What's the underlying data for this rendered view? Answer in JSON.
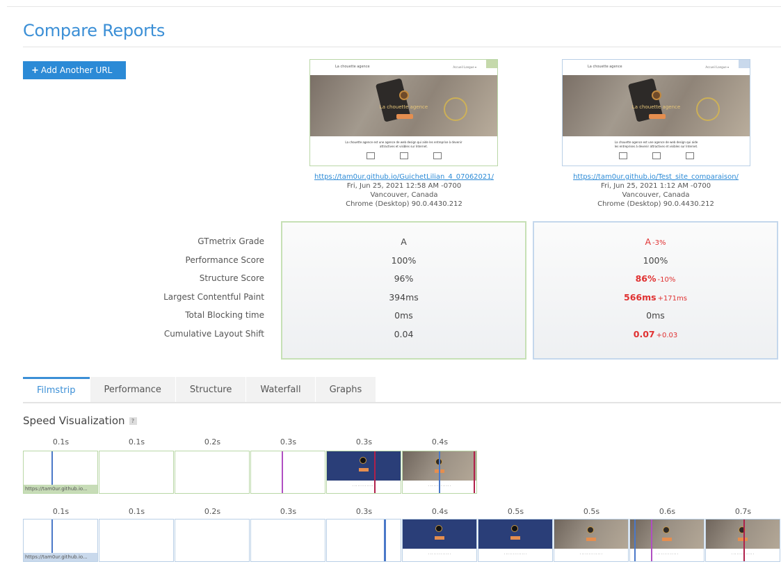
{
  "page": {
    "title": "Compare Reports"
  },
  "actions": {
    "add_url_label": "Add Another URL"
  },
  "colors": {
    "accent": "#3b8fd6",
    "report1_border": "#c6e0b5",
    "report2_border": "#c4d7ec",
    "good": "#3bb33b",
    "bad": "#e03131",
    "marker_purple": "#b04fc2",
    "marker_blue": "#4a78c8",
    "marker_red": "#b0204a"
  },
  "reports": [
    {
      "url": "https://tam0ur.github.io/GuichetLilian_4_07062021/",
      "date": "Fri, Jun 25, 2021 12:58 AM -0700",
      "location": "Vancouver, Canada",
      "browser": "Chrome (Desktop) 90.0.4430.212",
      "thumb": {
        "logo": "La chouette agence",
        "nav": "Accueil  Langue ▾",
        "hero_text": "La chouette agence",
        "body_line1": "La chouette agence est une agence de web design qui aide les entreprise à devenir",
        "body_line2": "attractives et visibles sur Internet."
      }
    },
    {
      "url": "https://tam0ur.github.io/Test_site_comparaison/",
      "date": "Fri, Jun 25, 2021 1:12 AM -0700",
      "location": "Vancouver, Canada",
      "browser": "Chrome (Desktop) 90.0.4430.212",
      "thumb": {
        "logo": "La chouette agence",
        "nav": "Accueil  Langue ▾",
        "hero_text": "La chouette agence",
        "body_line1": "La chouette agence est une agence de web design qui aide",
        "body_line2": "les entreprises à devenir attractives et visibles sur Internet."
      }
    }
  ],
  "metrics": {
    "labels": [
      "GTmetrix Grade",
      "Performance Score",
      "Structure Score",
      "Largest Contentful Paint",
      "Total Blocking time",
      "Cumulative Layout Shift"
    ],
    "report1": [
      {
        "value": "A",
        "delta": ""
      },
      {
        "value": "100%",
        "delta": ""
      },
      {
        "value": "96%",
        "delta": ""
      },
      {
        "value": "394ms",
        "delta": ""
      },
      {
        "value": "0ms",
        "delta": ""
      },
      {
        "value": "0.04",
        "delta": ""
      }
    ],
    "report2": [
      {
        "value": "A",
        "delta": "-3%"
      },
      {
        "value": "100%",
        "delta": ""
      },
      {
        "value": "86%",
        "delta": "-10%"
      },
      {
        "value": "566ms",
        "delta": "+171ms"
      },
      {
        "value": "0ms",
        "delta": ""
      },
      {
        "value": "0.07",
        "delta": "+0.03"
      }
    ]
  },
  "tabs": [
    "Filmstrip",
    "Performance",
    "Structure",
    "Waterfall",
    "Graphs"
  ],
  "filmstrip": {
    "title": "Speed Visualization",
    "help": "?",
    "row1": {
      "times": [
        "0.1s",
        "0.1s",
        "0.2s",
        "0.3s",
        "0.3s",
        "0.4s"
      ],
      "url_label": "https://tam0ur.github.io..."
    },
    "row2": {
      "times": [
        "0.1s",
        "0.1s",
        "0.2s",
        "0.3s",
        "0.3s",
        "0.4s",
        "0.5s",
        "0.5s",
        "0.6s",
        "0.7s"
      ],
      "url_label": "https://tam0ur.github.io..."
    }
  }
}
